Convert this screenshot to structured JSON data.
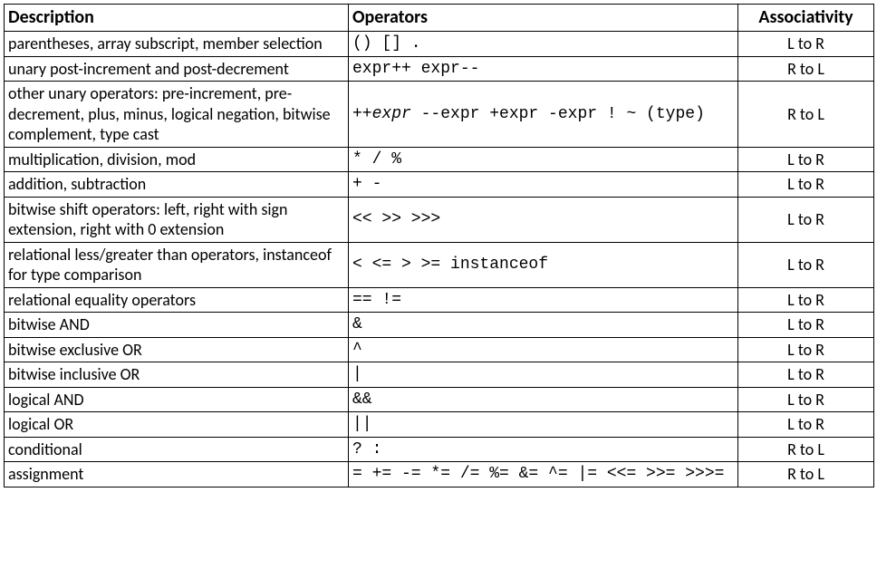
{
  "headers": {
    "description": "Description",
    "operators": "Operators",
    "associativity": "Associativity"
  },
  "rows": [
    {
      "desc": "parentheses, array subscript, member selection",
      "ops": "() [] .",
      "assoc": "L to R"
    },
    {
      "desc": "unary post-increment and post-decrement",
      "ops": "expr++ expr--",
      "assoc": "R to L"
    },
    {
      "desc": "other unary operators: pre-increment, pre-decrement, plus, minus, logical negation, bitwise complement, type cast",
      "ops_prefix_italic": "++expr",
      "ops_rest": " --expr +expr -expr ! ~ (type)",
      "assoc": "R to L"
    },
    {
      "desc": "multiplication, division, mod",
      "ops": "* / %",
      "assoc": "L to R"
    },
    {
      "desc": "addition, subtraction",
      "ops": "+ -",
      "assoc": "L to R"
    },
    {
      "desc": "bitwise shift operators: left, right with sign extension, right with 0 extension",
      "ops": "<< >> >>>",
      "assoc": "L to R"
    },
    {
      "desc": "relational less/greater than operators, instanceof for type comparison",
      "ops": "< <= > >= instanceof",
      "assoc": "L to R"
    },
    {
      "desc": "relational equality operators",
      "ops": "== !=",
      "assoc": "L to R"
    },
    {
      "desc": "bitwise AND",
      "ops": "&",
      "assoc": "L to R"
    },
    {
      "desc": "bitwise exclusive OR",
      "ops": "^",
      "assoc": "L to R"
    },
    {
      "desc": "bitwise inclusive OR",
      "ops": "|",
      "assoc": "L to R"
    },
    {
      "desc": "logical AND",
      "ops": "&&",
      "assoc": "L to R"
    },
    {
      "desc": "logical OR",
      "ops": "||",
      "assoc": "L to R"
    },
    {
      "desc": "conditional",
      "ops": "? :",
      "assoc": "R to L"
    },
    {
      "desc": "assignment",
      "ops": "= += -= *= /= %= &= ^= |= <<= >>= >>>=",
      "assoc": "R to L"
    }
  ]
}
